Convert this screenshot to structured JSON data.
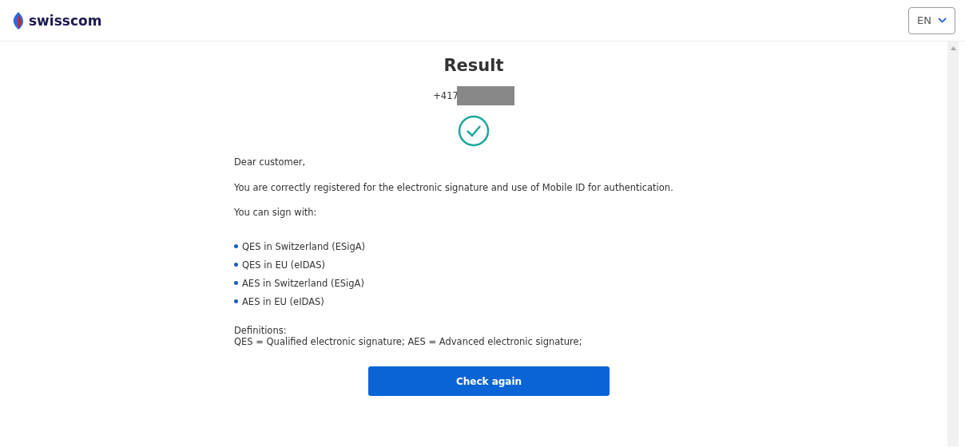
{
  "header": {
    "brand": "swisscom",
    "language": "EN"
  },
  "result": {
    "title": "Result",
    "phone": "+417",
    "phone_redacted": true,
    "greeting": "Dear customer,",
    "message": "You are correctly registered for the electronic signature and use of Mobile ID for authentication.",
    "list_intro": "You can sign with:",
    "options": [
      "QES in Switzerland (ESigA)",
      "QES in EU (eIDAS)",
      "AES in Switzerland (ESigA)",
      "AES in EU (eIDAS)"
    ],
    "definitions_title": "Definitions:",
    "definitions": "QES = Qualified electronic signature; AES = Advanced electronic signature;",
    "button": "Check again"
  }
}
